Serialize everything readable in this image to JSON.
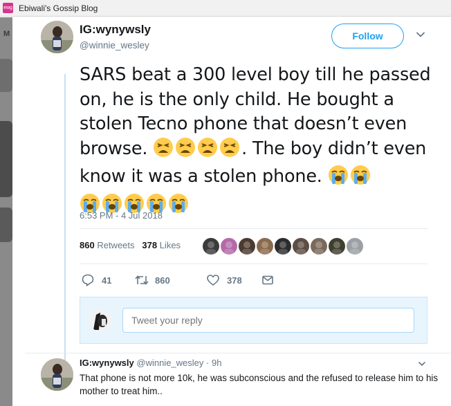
{
  "browser": {
    "tab_title": "Ebiwali's Gossip Blog",
    "favicon_text": "ewg"
  },
  "background": {
    "partial_letter": "M"
  },
  "tweet": {
    "display_name": "IG:wynywsly",
    "handle": "@winnie_wesley",
    "follow_label": "Follow",
    "text_part1": "SARS beat a 300 level boy till he passed on, he is the only child. He bought a stolen Tecno phone that doesn’t even browse.",
    "text_part2": ". The boy didn’t even know it was a stolen phone.",
    "emoji_group1": [
      "tired-face",
      "tired-face",
      "tired-face",
      "tired-face"
    ],
    "emoji_group2": [
      "crying-face",
      "crying-face"
    ],
    "emoji_group3": [
      "crying-face",
      "crying-face",
      "crying-face",
      "crying-face",
      "crying-face"
    ],
    "timestamp": "6:53 PM - 4 Jul 2018",
    "retweets_count": "860",
    "retweets_label": "Retweets",
    "likes_count": "378",
    "likes_label": "Likes",
    "liker_avatar_colors": [
      "#3b3b3b",
      "#b46aa8",
      "#4a3a30",
      "#8a6b4c",
      "#2c2c2c",
      "#5d4e44",
      "#7b6a5a",
      "#3e3f2e",
      "#9aa0a4"
    ],
    "actions": {
      "reply_count": "41",
      "retweet_count": "860",
      "like_count": "378"
    },
    "reply_placeholder": "Tweet your reply"
  },
  "reply": {
    "display_name": "IG:wynywsly",
    "handle": "@winnie_wesley",
    "separator": "·",
    "age": "9h",
    "text": "That phone is not more 10k, he was subconscious and the refused to release him to his mother to treat him.."
  },
  "colors": {
    "accent": "#1da1f2",
    "muted": "#657786",
    "reply_box_bg": "#e8f5fd"
  }
}
